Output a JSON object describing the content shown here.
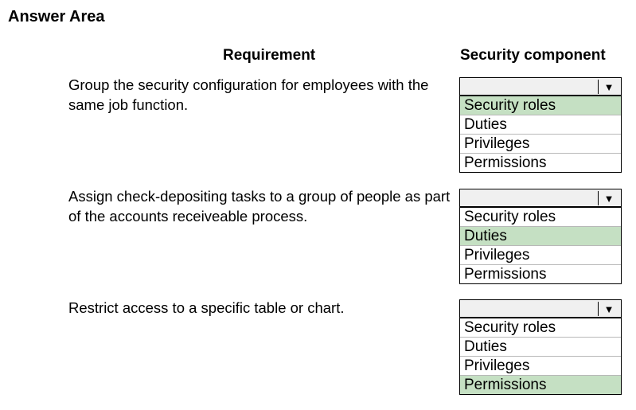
{
  "title": "Answer Area",
  "headers": {
    "requirement": "Requirement",
    "component": "Security component"
  },
  "rows": [
    {
      "requirement": "Group the security configuration for employees with the same job function.",
      "selected_value": "",
      "options": [
        {
          "label": "Security roles",
          "selected": true
        },
        {
          "label": "Duties",
          "selected": false
        },
        {
          "label": "Privileges",
          "selected": false
        },
        {
          "label": "Permissions",
          "selected": false
        }
      ]
    },
    {
      "requirement": "Assign check-depositing tasks to a group of people as part of the accounts receiveable process.",
      "selected_value": "",
      "options": [
        {
          "label": "Security roles",
          "selected": false
        },
        {
          "label": "Duties",
          "selected": true
        },
        {
          "label": "Privileges",
          "selected": false
        },
        {
          "label": "Permissions",
          "selected": false
        }
      ]
    },
    {
      "requirement": "Restrict access to a specific table or chart.",
      "selected_value": "",
      "options": [
        {
          "label": "Security roles",
          "selected": false
        },
        {
          "label": "Duties",
          "selected": false
        },
        {
          "label": "Privileges",
          "selected": false
        },
        {
          "label": "Permissions",
          "selected": true
        }
      ]
    }
  ],
  "colors": {
    "highlight": "#c5e0c3",
    "dropdown_bg": "#f0f0f0"
  },
  "icons": {
    "dropdown": "triangle-down"
  }
}
